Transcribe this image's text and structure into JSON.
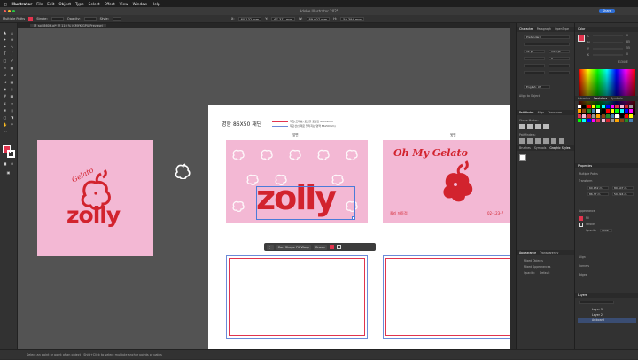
{
  "menubar": {
    "app": "Illustrator",
    "items": [
      "File",
      "Edit",
      "Object",
      "Type",
      "Select",
      "Effect",
      "View",
      "Window",
      "Help"
    ],
    "clock": ""
  },
  "window": {
    "title": "Adobe Illustrator 2025",
    "share": "Share"
  },
  "control_bar": {
    "selection": "Multiple Paths",
    "stroke_label": "Stroke:",
    "opacity_label": "Opacity:",
    "style_label": "Style:",
    "x": "60.132 mm",
    "y": "67.371 mm",
    "w": "89.607 mm",
    "h": "59.394 mm"
  },
  "document_tab": {
    "name": "대_sol_8606.ai* @ 110 % (CMYK/GPU Preview)"
  },
  "artboard_front": {
    "logo_script": "Gelato",
    "logo_word": "zolly"
  },
  "print_sheet": {
    "title": "명함 86X50 재단",
    "note1": "작업(트레팅) 도련을 포함한 88x52mm",
    "note2": "재단선(실제로 잘라지는 영역 86x50mm)",
    "label_front": "앞면",
    "label_back": "뒷면",
    "front_word": "zolly",
    "back_script": "Oh My Gelato",
    "back_footer_left": "졸리 저동점",
    "back_footer_right": "02-123-7"
  },
  "context_bar": {
    "item1": "Con Shape Fit Warp",
    "item2": "Group"
  },
  "status_bar": {
    "text": "Select an point or point of an object  |  Shift+Click to select multiple anchor points or paths"
  },
  "character_panel": {
    "tabs": [
      "Character",
      "Paragraph",
      "OpenType"
    ],
    "font": "Pretendard",
    "size": "12 pt",
    "leading": "14.4 pt",
    "tracking": "0",
    "language": "English: US",
    "align_label": "Align to Object"
  },
  "pathfinder_panel": {
    "tabs": [
      "Pathfinder",
      "Align",
      "Transform"
    ],
    "shape_modes": "Shape Modes:",
    "pathfinders": "Pathfinders:"
  },
  "brushes_panel": {
    "tabs": [
      "Brushes",
      "Symbols",
      "Graphic Styles"
    ]
  },
  "appearance_panel": {
    "tabs": [
      "Appearance",
      "Transparency"
    ],
    "row1": "Mixed Objects",
    "row2": "Mixed Appearances",
    "opacity_label": "Opacity:",
    "opacity_value": "Default"
  },
  "color_panel": {
    "tabs": [
      "Color"
    ],
    "c": "0",
    "m": "85",
    "y": "55",
    "k": "0",
    "hex": "E1344E"
  },
  "swatches_panel": {
    "tabs": [
      "Libraries",
      "Swatches",
      "Symbols"
    ]
  },
  "properties_panel": {
    "title": "Properties",
    "subtitle": "Multiple Paths",
    "transform_label": "Transform",
    "x": "60.132 m",
    "y": "86.37 m",
    "w": "89.607 m",
    "h": "59.394 m",
    "appearance_label": "Appearance",
    "fill_label": "Fill",
    "stroke_label": "Stroke",
    "opacity_label": "Opacity",
    "opacity_value": "100%",
    "align_label": "Align",
    "corners_label": "Corners",
    "edges_label": "Edges"
  },
  "layers_panel": {
    "tabs": [
      "Layers"
    ],
    "layers": [
      "Layer 3",
      "Layer 2",
      "Artboard"
    ]
  },
  "colors": {
    "accent": "#e1344e",
    "pink": "#f3b8d4",
    "brand_red": "#d2232e"
  }
}
